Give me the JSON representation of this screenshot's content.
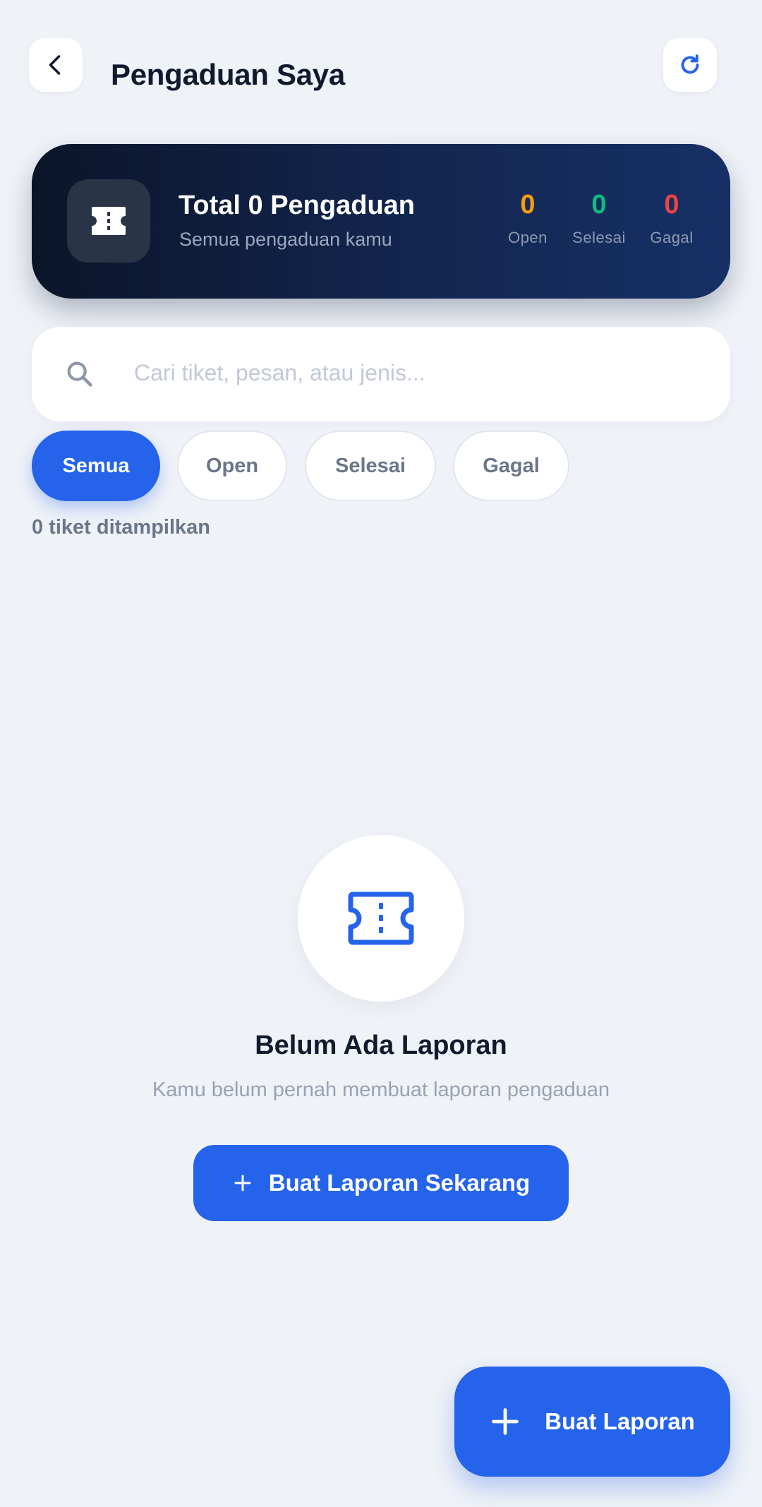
{
  "header": {
    "title": "Pengaduan Saya",
    "back_icon": "chevron-left-icon",
    "refresh_icon": "refresh-icon"
  },
  "summary": {
    "icon": "ticket-icon",
    "title": "Total 0 Pengaduan",
    "subtitle": "Semua pengaduan kamu",
    "stats": [
      {
        "value": "0",
        "label": "Open",
        "color": "#f59e0b"
      },
      {
        "value": "0",
        "label": "Selesai",
        "color": "#10b981"
      },
      {
        "value": "0",
        "label": "Gagal",
        "color": "#ef4444"
      }
    ]
  },
  "search": {
    "placeholder": "Cari tiket, pesan, atau jenis...",
    "value": ""
  },
  "filters": [
    {
      "label": "Semua",
      "active": true
    },
    {
      "label": "Open",
      "active": false
    },
    {
      "label": "Selesai",
      "active": false
    },
    {
      "label": "Gagal",
      "active": false
    }
  ],
  "count_text": "0 tiket ditampilkan",
  "empty_state": {
    "icon": "ticket-icon",
    "title": "Belum Ada Laporan",
    "subtitle": "Kamu belum pernah membuat laporan pengaduan",
    "button_label": "Buat Laporan Sekarang"
  },
  "fab": {
    "label": "Buat Laporan",
    "icon": "plus-icon"
  },
  "colors": {
    "accent": "#2563eb",
    "background": "#eff2f7",
    "card_dark": "#0b1529"
  }
}
